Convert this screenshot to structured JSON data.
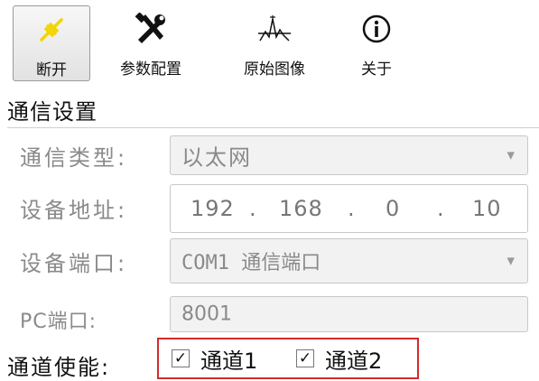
{
  "toolbar": {
    "buttons": [
      {
        "label": "断开",
        "icon": "connect-plug-icon",
        "active": true
      },
      {
        "label": "参数配置",
        "icon": "tools-icon",
        "active": false
      },
      {
        "label": "原始图像",
        "icon": "waveform-icon",
        "active": false
      },
      {
        "label": "关于",
        "icon": "info-icon",
        "active": false
      }
    ]
  },
  "comm": {
    "section_title": "通信设置",
    "type_label": "通信类型:",
    "type_value": "以太网",
    "address_label": "设备地址:",
    "ip": [
      "192",
      "168",
      "0",
      "10"
    ],
    "port_label": "设备端口:",
    "port_value": "COM1 通信端口",
    "pc_port_label": "PC端口:",
    "pc_port_value": "8001",
    "channel_label": "通道使能:",
    "channels": [
      {
        "label": "通道1",
        "checked": true
      },
      {
        "label": "通道2",
        "checked": true
      }
    ]
  },
  "colors": {
    "highlight_border": "#d22b2b",
    "active_icon": "#f2d400"
  }
}
